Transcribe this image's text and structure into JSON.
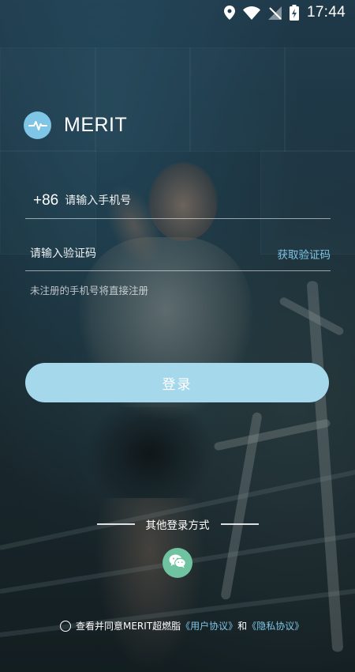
{
  "status_bar": {
    "time": "17:44"
  },
  "app": {
    "name": "MERIT"
  },
  "phone": {
    "country_code": "+86",
    "placeholder": "请输入手机号"
  },
  "code": {
    "placeholder": "请输入验证码",
    "get_code_label": "获取验证码"
  },
  "hint": "未注册的手机号将直接注册",
  "login_label": "登录",
  "other_login": {
    "label": "其他登录方式",
    "wechat_icon": "wechat-icon"
  },
  "agreement": {
    "prefix": "查看并同意MERIT超燃脂",
    "user_agreement": "《用户协议》",
    "and": "和",
    "privacy_agreement": "《隐私协议》"
  },
  "colors": {
    "accent": "#7ec5e6",
    "button": "#a6d8ec",
    "wechat": "#6fc3a1"
  }
}
